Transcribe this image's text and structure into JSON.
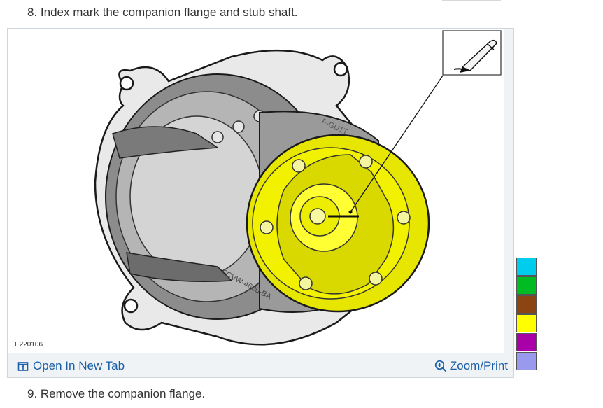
{
  "steps": {
    "step8": "8. Index mark the companion flange and stub shaft.",
    "step9": "9. Remove the companion flange."
  },
  "figure": {
    "id_label": "E220106",
    "engraving_top": "F-GU1T",
    "engraving_bottom": "FCVW-4600-BA",
    "open_link_label": "Open In New Tab",
    "zoom_link_label": "Zoom/Print",
    "highlight_color": "#f2f200",
    "open_icon": "open-in-new-tab-icon",
    "zoom_icon": "magnifier-plus-icon",
    "callout_icon": "marker-pen-icon"
  },
  "color_swatches": [
    "#00ccee",
    "#00bb22",
    "#8b4513",
    "#ffff00",
    "#aa00aa",
    "#9999ee"
  ]
}
